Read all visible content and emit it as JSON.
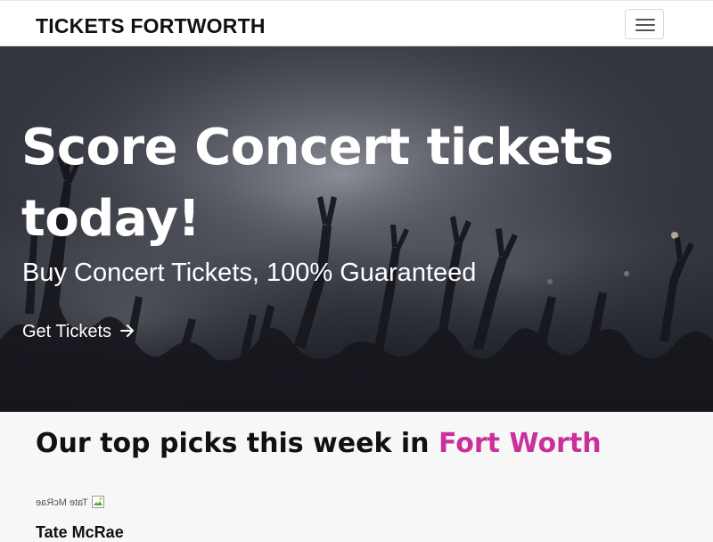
{
  "navbar": {
    "brand": "TICKETS FORTWORTH",
    "menu_icon": "hamburger-menu-icon"
  },
  "hero": {
    "title": "Score Concert tickets today!",
    "subtitle": "Buy Concert Tickets, 100% Guaranteed",
    "cta_label": "Get Tickets",
    "cta_icon": "arrow-right-icon"
  },
  "picks": {
    "heading_prefix": "Our top picks this week in",
    "heading_city": "Fort Worth",
    "items": [
      {
        "image_alt": "Tate McRae",
        "name": "Tate McRae"
      }
    ]
  },
  "colors": {
    "accent": "#c9309a",
    "text_dark": "#111111",
    "hero_overlay": "#2a2c33",
    "section_bg": "#f7f7f7"
  }
}
